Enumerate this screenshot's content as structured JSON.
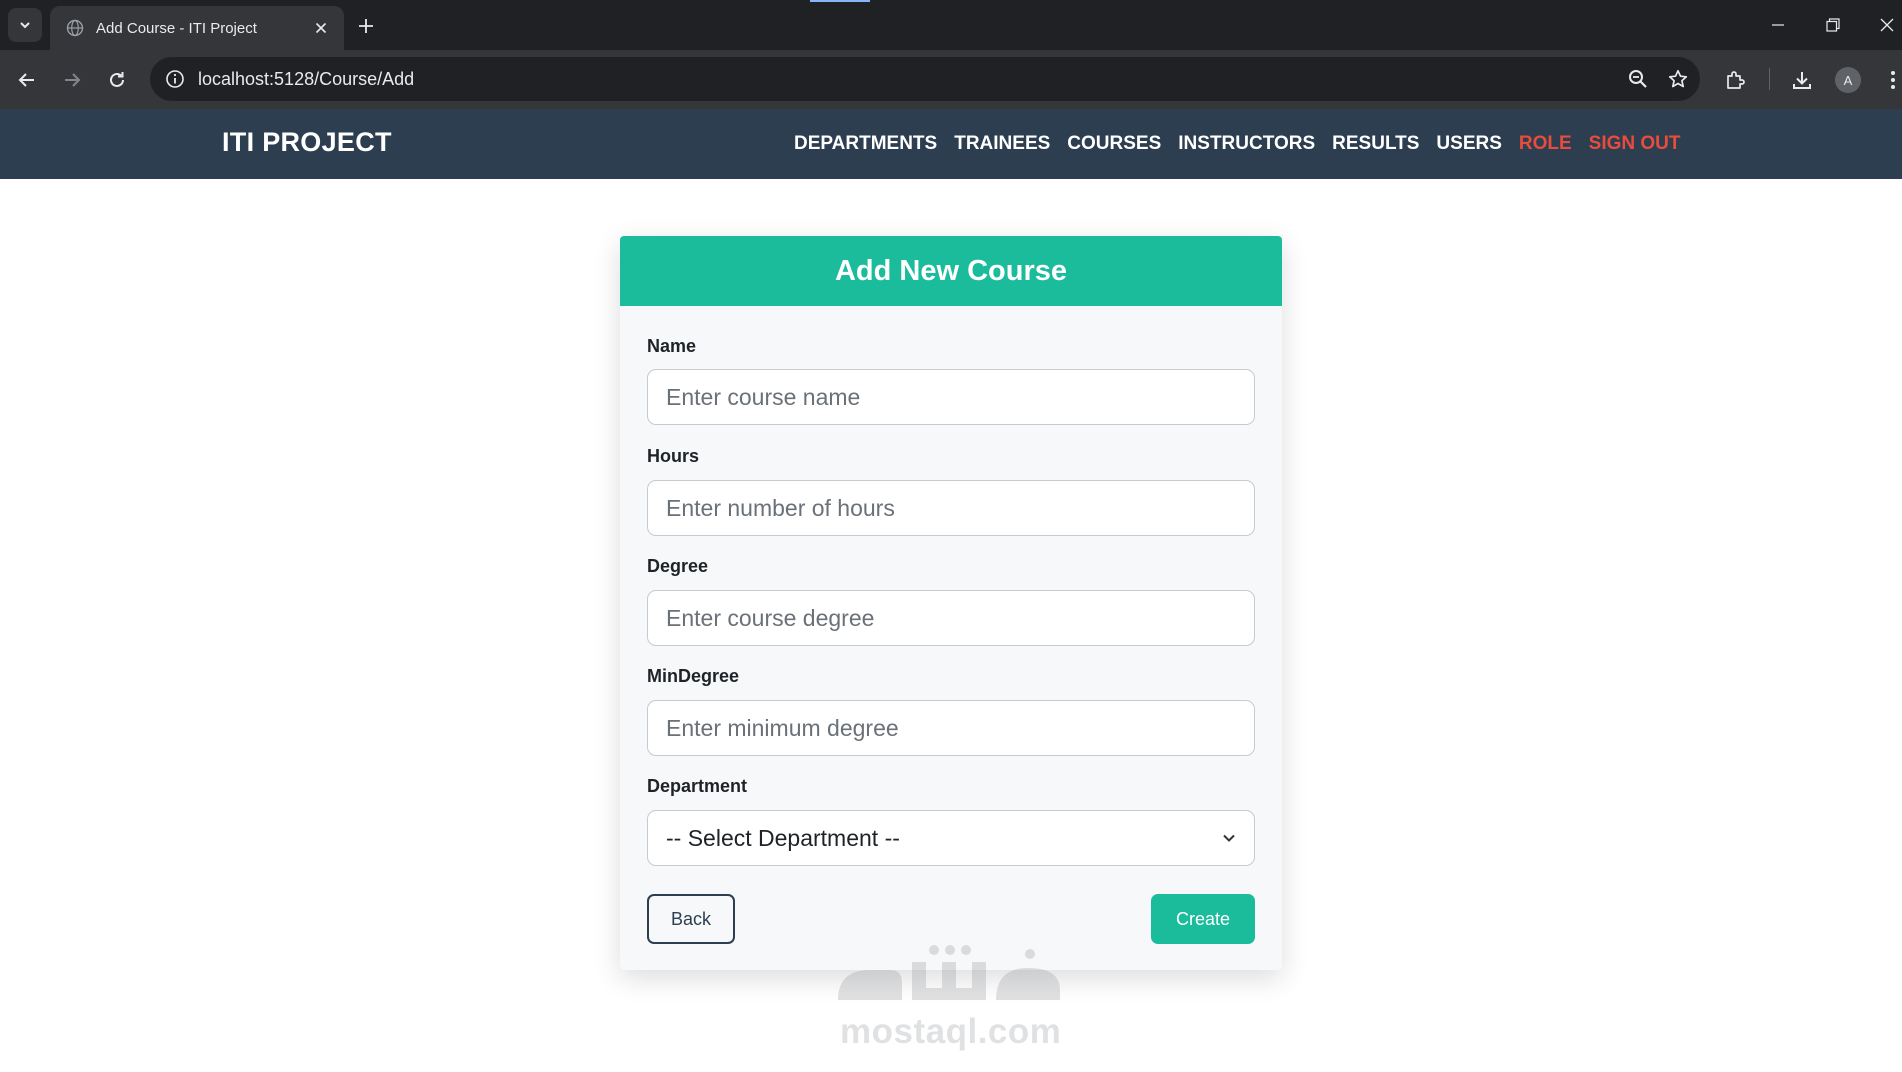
{
  "browser": {
    "tab_title": "Add Course - ITI Project",
    "url": "localhost:5128/Course/Add",
    "profile_initial": "A"
  },
  "navbar": {
    "brand": "ITI PROJECT",
    "links": [
      {
        "label": "DEPARTMENTS"
      },
      {
        "label": "TRAINEES"
      },
      {
        "label": "COURSES"
      },
      {
        "label": "INSTRUCTORS"
      },
      {
        "label": "RESULTS"
      },
      {
        "label": "USERS"
      },
      {
        "label": "ROLE"
      },
      {
        "label": "SIGN OUT"
      }
    ],
    "accent_color": "#e74c3c"
  },
  "form": {
    "title": "Add New Course",
    "fields": {
      "name": {
        "label": "Name",
        "placeholder": "Enter course name",
        "value": ""
      },
      "hours": {
        "label": "Hours",
        "placeholder": "Enter number of hours",
        "value": ""
      },
      "degree": {
        "label": "Degree",
        "placeholder": "Enter course degree",
        "value": ""
      },
      "min_degree": {
        "label": "MinDegree",
        "placeholder": "Enter minimum degree",
        "value": ""
      }
    },
    "department": {
      "label": "Department",
      "selected": "-- Select Department --"
    },
    "back_label": "Back",
    "create_label": "Create"
  },
  "watermark": {
    "text": "mostaql.com"
  },
  "colors": {
    "header_bg": "#2c3e50",
    "primary": "#1abc9c",
    "danger": "#e74c3c"
  }
}
